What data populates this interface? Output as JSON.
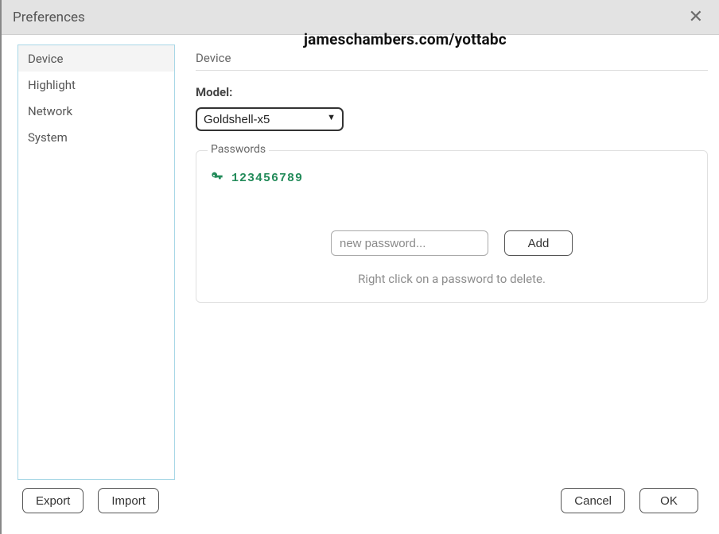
{
  "title": "Preferences",
  "watermark": "jameschambers.com/yottabc",
  "sidebar": {
    "items": [
      {
        "label": "Device",
        "active": true
      },
      {
        "label": "Highlight",
        "active": false
      },
      {
        "label": "Network",
        "active": false
      },
      {
        "label": "System",
        "active": false
      }
    ]
  },
  "main": {
    "section_title": "Device",
    "model_label": "Model:",
    "model_selected": "Goldshell-x5",
    "passwords": {
      "legend": "Passwords",
      "entries": [
        "123456789"
      ],
      "new_placeholder": "new password...",
      "add_label": "Add",
      "hint": "Right click on a password to delete."
    }
  },
  "footer": {
    "export_label": "Export",
    "import_label": "Import",
    "cancel_label": "Cancel",
    "ok_label": "OK"
  }
}
